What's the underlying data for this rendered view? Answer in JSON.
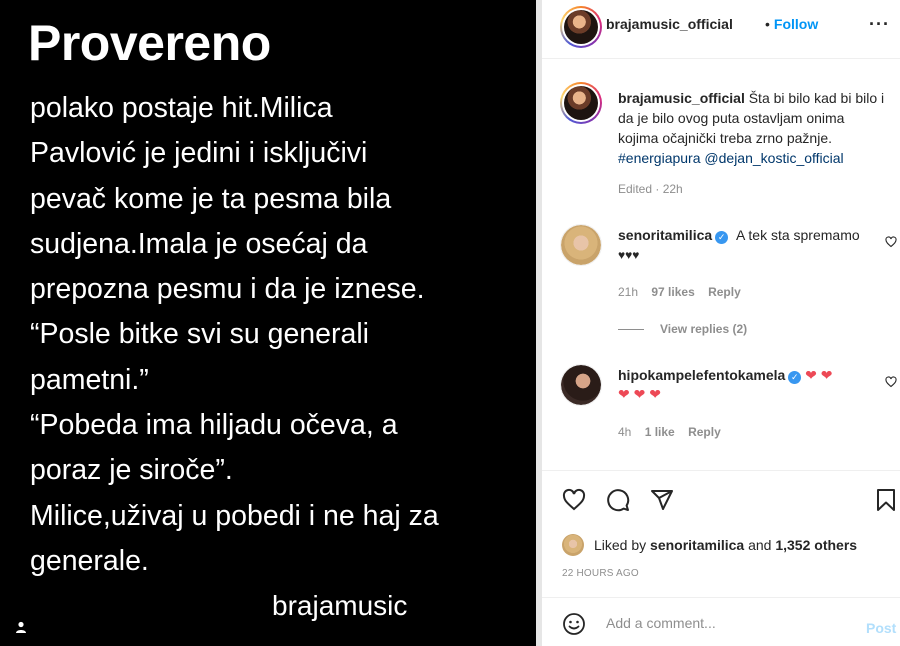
{
  "post_image": {
    "heading": "Provereno",
    "lines": [
      "polako postaje hit.Milica",
      "Pavlović je jedini i isključivi",
      "pevač kome je ta pesma bila",
      "sudjena.Imala je osećaj da",
      "prepozna pesmu i da je iznese.",
      "“Posle bitke svi su generali",
      "pametni.”",
      "“Pobeda ima hiljadu očeva, a",
      "poraz je siroče”.",
      "Milice,uživaj u pobedi i ne haj za",
      "generale."
    ],
    "signature": "brajamusic",
    "tag_icon": "user-tag-icon"
  },
  "header": {
    "username": "brajamusic_official",
    "separator": "•",
    "follow_label": "Follow",
    "more_icon": "more-options-icon",
    "more_glyph": "···"
  },
  "caption": {
    "username": "brajamusic_official",
    "text": "Šta bi bilo kad bi bilo i da je bilo ovog puta ostavljam onima kojima očajnički treba zrno pažnje.",
    "hashtag": "#energiapura",
    "mention": "@dejan_kostic_official",
    "edited": "Edited · 22h"
  },
  "comments": [
    {
      "username": "senoritamilica",
      "text": "A tek sta spremamo",
      "emoji": "♥♥♥",
      "time": "21h",
      "likes": "97 likes",
      "reply": "Reply",
      "view_replies": "View replies (2)"
    },
    {
      "username": "hipokampelefentokamela",
      "emoji_inline": "❤ ❤",
      "emoji_second_line": "❤ ❤ ❤",
      "time": "4h",
      "likes": "1 like",
      "reply": "Reply"
    }
  ],
  "actions": {
    "icons": [
      "heart-icon",
      "comment-icon",
      "share-icon",
      "bookmark-icon"
    ]
  },
  "likes": {
    "prefix": "Liked by",
    "user": "senoritamilica",
    "and": "and",
    "others": "1,352 others"
  },
  "timestamp": "22 HOURS AGO",
  "add_comment": {
    "placeholder": "Add a comment...",
    "post_label": "Post",
    "emoji_icon": "emoji-icon"
  },
  "colors": {
    "accent": "#0095f6",
    "heart": "#ed4956",
    "post_disabled": "#b2dffc",
    "verified": "#3897f0"
  }
}
